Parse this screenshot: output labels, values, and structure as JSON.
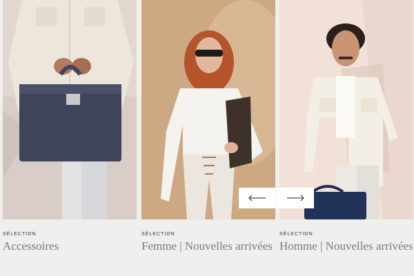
{
  "carousel": {
    "cards": [
      {
        "eyebrow": "SÉLECTION",
        "title": "Accessoires",
        "image_icon": "product-photo"
      },
      {
        "eyebrow": "SÉLECTION",
        "title": "Femme | Nouvelles arrivées",
        "image_icon": "product-photo"
      },
      {
        "eyebrow": "SÉLECTION",
        "title": "Homme | Nouvelles arrivées",
        "image_icon": "product-photo"
      }
    ],
    "controls": {
      "prev_icon": "arrow-left-icon",
      "next_icon": "arrow-right-icon"
    }
  },
  "colors": {
    "background": "#efefee",
    "caption_text": "#7b7b7b",
    "button_bg": "#ffffff"
  }
}
